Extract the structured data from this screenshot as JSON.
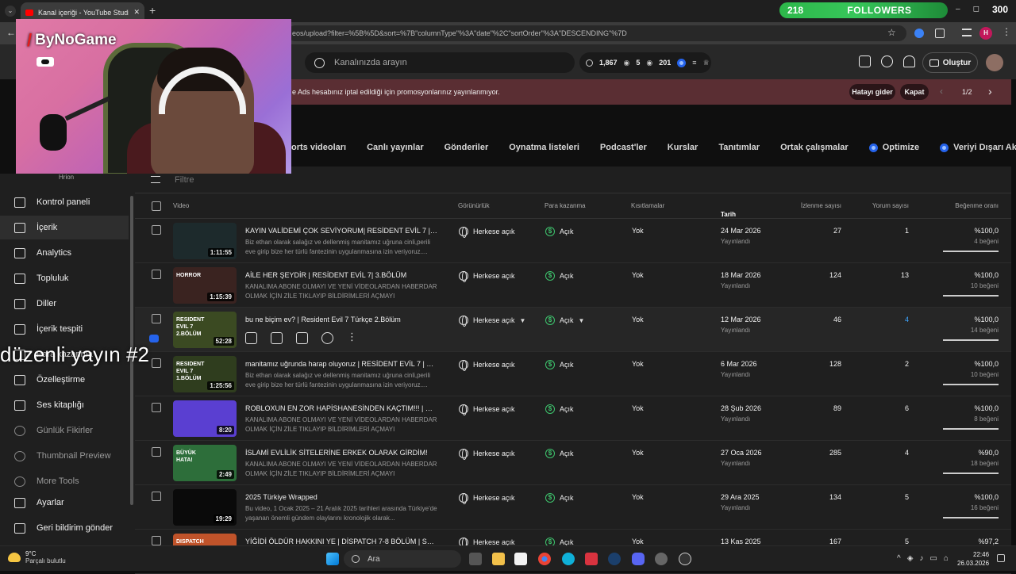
{
  "browser": {
    "tab_title": "Kanal içeriği - YouTube Studio",
    "url": "eos/upload?filter=%5B%5D&sort=%7B\"columnType\"%3A\"date\"%2C\"sortOrder\"%3A\"DESCENDING\"%7D",
    "profile_letter": "H"
  },
  "stream_overlay": {
    "followers_count": "218",
    "followers_label": "FOLLOWERS",
    "followers_goal": "300",
    "logo_text": "ByNoGame",
    "caption": "düzenli yayın #2"
  },
  "header": {
    "search_placeholder": "Kanalınızda arayın",
    "stat_1": "1,867",
    "stat_2": "5",
    "stat_3": "201",
    "create_label": "Oluştur"
  },
  "banner": {
    "message": "e Ads hesabınız iptal edildiği için promosyonlarınız yayınlanmıyor.",
    "fix_label": "Hatayı gider",
    "close_label": "Kapat",
    "pager": "1/2"
  },
  "tabs": [
    {
      "label": "orts videoları"
    },
    {
      "label": "Canlı yayınlar"
    },
    {
      "label": "Gönderiler"
    },
    {
      "label": "Oynatma listeleri"
    },
    {
      "label": "Podcast'ler"
    },
    {
      "label": "Kurslar"
    },
    {
      "label": "Tanıtımlar"
    },
    {
      "label": "Ortak çalışmalar"
    },
    {
      "label": "Optimize"
    },
    {
      "label": "Veriyi Dışarı Aktarın"
    }
  ],
  "sidebar": {
    "channel_name": "Hrion",
    "items": [
      {
        "label": "Kontrol paneli"
      },
      {
        "label": "İçerik"
      },
      {
        "label": "Analytics"
      },
      {
        "label": "Topluluk"
      },
      {
        "label": "Diller"
      },
      {
        "label": "İçerik tespiti"
      },
      {
        "label": "Para kazanma"
      },
      {
        "label": "Özelleştirme"
      },
      {
        "label": "Ses kitaplığı"
      },
      {
        "label": "Günlük Fikirler"
      },
      {
        "label": "Thumbnail Preview"
      },
      {
        "label": "More Tools"
      },
      {
        "label": "Ayarlar"
      },
      {
        "label": "Geri bildirim gönder"
      }
    ]
  },
  "table": {
    "filter_placeholder": "Filtre",
    "columns": {
      "video": "Video",
      "visibility": "Görünürlük",
      "monetization": "Para kazanma",
      "restrictions": "Kısıtlamalar",
      "date": "Tarih",
      "views": "İzlenme sayısı",
      "comments": "Yorum sayısı",
      "likes": "Beğenme oranı"
    },
    "rows": [
      {
        "title": "KAYIN VALİDEMİ ÇOK SEVİYORUM| RESİDENT EVİL 7 | 4 BÖLÜM",
        "desc": "Biz ethan olarak salağız ve dellenmiş manitamız uğruna cinli,perili eve girip bize her türlü fantezinin uygulanmasına izin veriyoruz....",
        "duration": "1:11:55",
        "visibility": "Herkese açık",
        "monetization": "Açık",
        "restrictions": "Yok",
        "date": "24 Mar 2026",
        "status": "Yayınlandı",
        "views": "27",
        "comments": "1",
        "like_ratio": "%100,0",
        "likes": "4 beğeni",
        "thumb_text": "",
        "thumb_color": "#1d2a2c"
      },
      {
        "title": "AİLE HER ŞEYDİR | RESİDENT EVİL 7| 3.BÖLÜM",
        "desc": "KANALIMA ABONE OLMAYI VE YENİ VİDEOLARDAN HABERDAR OLMAK İÇİN ZİLE TIKLAYIP BİLDİRİMLERİ AÇMAYI UNUTMAYIN!...",
        "duration": "1:15:39",
        "visibility": "Herkese açık",
        "monetization": "Açık",
        "restrictions": "Yok",
        "date": "18 Mar 2026",
        "status": "Yayınlandı",
        "views": "124",
        "comments": "13",
        "like_ratio": "%100,0",
        "likes": "10 beğeni",
        "thumb_text": "HORROR",
        "thumb_color": "#3a2320"
      },
      {
        "title": "bu ne biçim ev? | Resident Evil 7 Türkçe 2.Bölüm",
        "desc": "",
        "duration": "52:28",
        "visibility": "Herkese açık",
        "monetization": "Açık",
        "restrictions": "Yok",
        "date": "12 Mar 2026",
        "status": "Yayınlandı",
        "views": "46",
        "comments": "4",
        "like_ratio": "%100,0",
        "likes": "14 beğeni",
        "thumb_text": "RESIDENT EVIL 7 2.BÖLÜM",
        "thumb_color": "#3b4a22"
      },
      {
        "title": "manitamız uğrunda harap oluyoruz | RESİDENT EVİL 7 | 1.BÖLÜM",
        "desc": "Biz ethan olarak salağız ve dellenmiş manitamız uğruna cinli,perili eve girip bize her türlü fantezinin uygulanmasına izin veriyoruz....",
        "duration": "1:25:56",
        "visibility": "Herkese açık",
        "monetization": "Açık",
        "restrictions": "Yok",
        "date": "6 Mar 2026",
        "status": "Yayınlandı",
        "views": "128",
        "comments": "2",
        "like_ratio": "%100,0",
        "likes": "10 beğeni",
        "thumb_text": "RESIDENT EVIL 7 1.BÖLÜM",
        "thumb_color": "#2f3d1e"
      },
      {
        "title": "ROBLOXUN EN ZOR HAPİSHANESİNDEN KAÇTIM!!! | Roblox ...",
        "desc": "KANALIMA ABONE OLMAYI VE YENİ VİDEOLARDAN HABERDAR OLMAK İÇİN ZİLE TIKLAYIP BİLDİRİMLERİ AÇMAYI UNUTMAYIN!...",
        "duration": "8:20",
        "visibility": "Herkese açık",
        "monetization": "Açık",
        "restrictions": "Yok",
        "date": "28 Şub 2026",
        "status": "Yayınlandı",
        "views": "89",
        "comments": "6",
        "like_ratio": "%100,0",
        "likes": "8 beğeni",
        "thumb_text": "",
        "thumb_color": "#5a3fd1"
      },
      {
        "title": "İSLAMİ EVLİLİK SİTELERİNE ERKEK OLARAK GİRDİM!",
        "desc": "KANALIMA ABONE OLMAYI VE YENİ VİDEOLARDAN HABERDAR OLMAK İÇİN ZİLE TIKLAYIP BİLDİRİMLERİ AÇMAYI UNUTMAYIN!...",
        "duration": "2:49",
        "visibility": "Herkese açık",
        "monetization": "Açık",
        "restrictions": "Yok",
        "date": "27 Oca 2026",
        "status": "Yayınlandı",
        "views": "285",
        "comments": "4",
        "like_ratio": "%90,0",
        "likes": "18 beğeni",
        "thumb_text": "BÜYÜK HATA!",
        "thumb_color": "#2d6e3a"
      },
      {
        "title": "2025 Türkiye Wrapped",
        "desc": "Bu video, 1 Ocak 2025 – 21 Aralık 2025 tarihleri arasında Türkiye'de yaşanan önemli gündem olaylarını kronolojik olarak...",
        "duration": "19:29",
        "visibility": "Herkese açık",
        "monetization": "Açık",
        "restrictions": "Yok",
        "date": "29 Ara 2025",
        "status": "Yayınlandı",
        "views": "134",
        "comments": "5",
        "like_ratio": "%100,0",
        "likes": "16 beğeni",
        "thumb_text": "",
        "thumb_color": "#0a0a0a"
      },
      {
        "title": "YİĞİDİ ÖLDÜR HAKKINI YE | DİSPATCH 7-8 BÖLÜM | SEZON F...",
        "desc": "",
        "duration": "",
        "visibility": "Herkese açık",
        "monetization": "Açık",
        "restrictions": "Yok",
        "date": "13 Kas 2025",
        "status": "",
        "views": "167",
        "comments": "5",
        "like_ratio": "%97,2",
        "likes": "",
        "thumb_text": "DISPATCH",
        "thumb_color": "#c0532a"
      }
    ]
  },
  "taskbar": {
    "temperature": "9°C",
    "weather": "Parçalı bulutlu",
    "search_label": "Ara",
    "time": "22:46",
    "date": "26.03.2026"
  }
}
